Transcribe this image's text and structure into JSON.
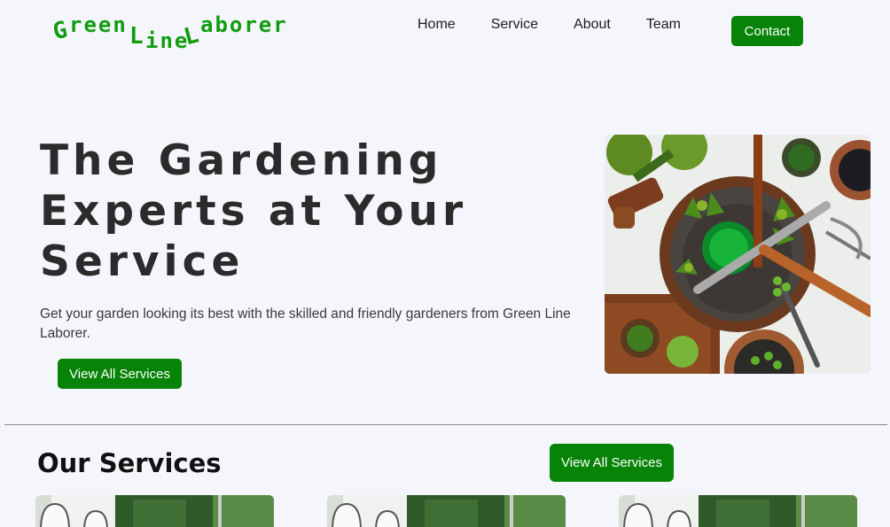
{
  "header": {
    "logo": {
      "g_cap": "G",
      "g_low": "reen",
      "l_cap": "L",
      "l_low": "ine",
      "l2_cap": "L",
      "l2_low": "aborer"
    },
    "nav": [
      "Home",
      "Service",
      "About",
      "Team"
    ],
    "contact_label": "Contact"
  },
  "hero": {
    "title": "The Gardening Experts at Your Service",
    "subtitle": "Get your garden looking its best with the skilled and friendly gardeners from Green Line Laborer.",
    "button_label": "View All Services"
  },
  "services": {
    "title": "Our Services",
    "button_label": "View All Services",
    "cards": [
      {
        "icon": "house-garden-photo"
      },
      {
        "icon": "house-garden-photo"
      },
      {
        "icon": "house-garden-photo"
      }
    ]
  },
  "colors": {
    "accent": "#078307",
    "logo": "#0f9d0f",
    "background": "#f4f6fb"
  }
}
